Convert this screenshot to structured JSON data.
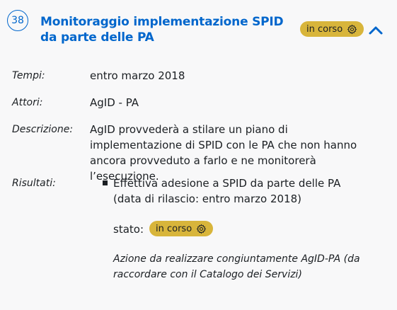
{
  "item": {
    "number": "38",
    "title": "Monitoraggio implementazione SPID da parte delle PA",
    "status": "in corso",
    "expand_icon": "chevron-up-icon",
    "status_icon": "gear-icon"
  },
  "fields": {
    "tempi_label": "Tempi:",
    "tempi_value": "entro marzo 2018",
    "attori_label": "Attori:",
    "attori_value": "AgID - PA",
    "descrizione_label": "Descrizione:",
    "descrizione_value": "AgID provvederà a stilare un piano di implementazione di SPID con le PA che non hanno ancora provveduto a farlo e ne monitorerà l’esecuzione.",
    "risultati_label": "Risultati:"
  },
  "result": {
    "text": "Effettiva adesione a SPID da parte delle PA (data di rilascio: entro marzo 2018)",
    "stato_label": "stato:",
    "stato_value": "in corso",
    "note": "Azione da realizzare congiuntamente AgID-PA (da raccordare con il Catalogo dei Servizi)"
  },
  "colors": {
    "accent": "#0066cc",
    "status_pill": "#d8b53b",
    "background": "#f8f8f9"
  }
}
